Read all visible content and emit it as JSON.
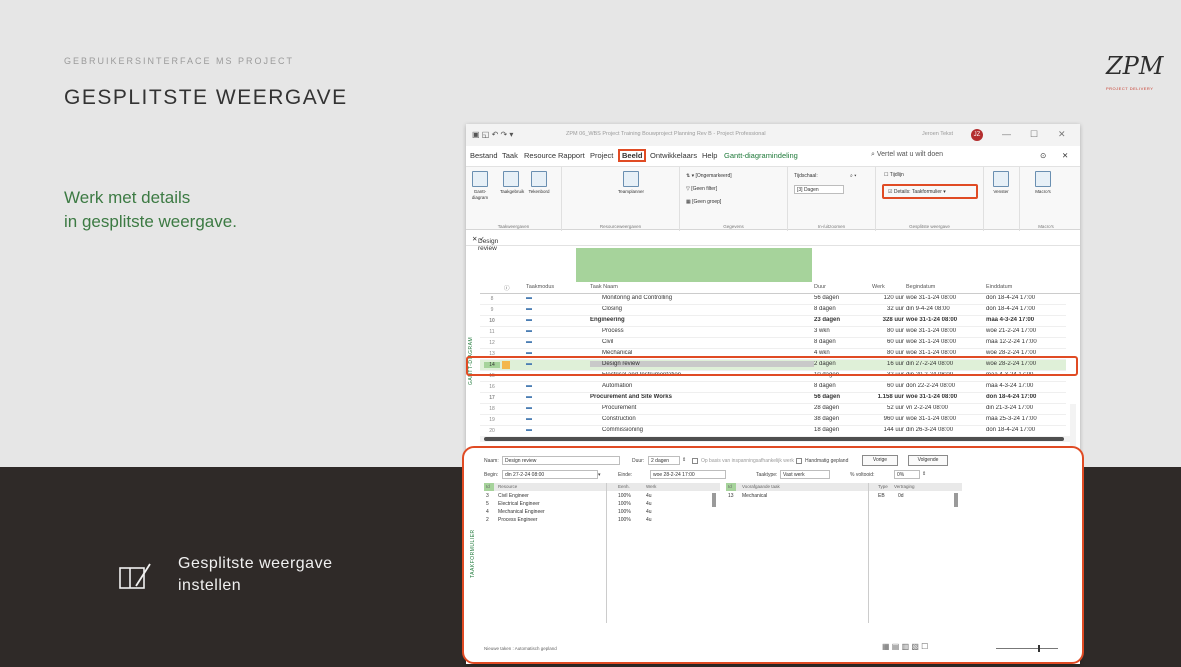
{
  "slide": {
    "eyebrow": "GEBRUIKERSINTERFACE MS PROJECT",
    "title": "GESPLITSTE WEERGAVE",
    "lead": "Werk met details\nin gesplitste weergave.",
    "note": "Gesplitste weergave\ninstellen",
    "logo_mark": "ZPM",
    "logo_sub": "PROJECT DELIVERY"
  },
  "app": {
    "titlebar": {
      "title": "ZPM 06_WBS Project Training Bouwproject Planning Rev B - Project Professional",
      "user": "Jeroen Tekst",
      "avatar": "JZ"
    },
    "menu": [
      "Bestand",
      "Taak",
      "Resource",
      "Rapport",
      "Project",
      "Beeld",
      "Ontwikkelaars",
      "Help",
      "Gantt-diagramindeling"
    ],
    "menu_active": "Beeld",
    "search": "Vertel wat u wilt doen",
    "ribbon": {
      "groups": [
        "Taakweergaven",
        "Resourceweergaven",
        "Gegevens",
        "In-/uitzoomen",
        "Gesplitste weergave",
        "Macro's"
      ],
      "buttons": [
        "Gantt-diagram",
        "Taakgebruik",
        "Tekenbord",
        "Teamplanner",
        "Venster",
        "Macro's"
      ],
      "small": {
        "ongemarkeerd": "[Ongemarkeerd]",
        "geen_filter": "[Geen filter]",
        "geen_groep": "[Geen groep]",
        "tijdschaal": "Tijdschaal:",
        "dagen": "[3] Dagen",
        "tijdlijn": "Tijdlijn",
        "details": "Details: Taakformulier"
      }
    },
    "formula_value": "Design review",
    "gantt": {
      "side_label": "GANTT-DIAGRAM",
      "columns": [
        "Taakmodus",
        "Taak Naam",
        "Duur",
        "Werk",
        "Begindatum",
        "Einddatum"
      ],
      "rows": [
        {
          "id": "8",
          "name": "Monitoring and Controlling",
          "dur": "56 dagen",
          "work": "120 uur",
          "start": "woe 31-1-24 08:00",
          "end": "don 18-4-24 17:00",
          "indent": 1
        },
        {
          "id": "9",
          "name": "Closing",
          "dur": "8 dagen",
          "work": "32 uur",
          "start": "din 9-4-24 08:00",
          "end": "don 18-4-24 17:00",
          "indent": 1
        },
        {
          "id": "10",
          "name": "Engineering",
          "dur": "23 dagen",
          "work": "328 uur",
          "start": "woe 31-1-24 08:00",
          "end": "maa 4-3-24 17:00",
          "indent": 0,
          "summary": true
        },
        {
          "id": "11",
          "name": "Process",
          "dur": "3 wkn",
          "work": "80 uur",
          "start": "woe 31-1-24 08:00",
          "end": "woe 21-2-24 17:00",
          "indent": 1
        },
        {
          "id": "12",
          "name": "Civil",
          "dur": "8 dagen",
          "work": "60 uur",
          "start": "woe 31-1-24 08:00",
          "end": "maa 12-2-24 17:00",
          "indent": 1
        },
        {
          "id": "13",
          "name": "Mechanical",
          "dur": "4 wkn",
          "work": "80 uur",
          "start": "woe 31-1-24 08:00",
          "end": "woe 28-2-24 17:00",
          "indent": 1
        },
        {
          "id": "14",
          "name": "Design review",
          "dur": "2 dagen",
          "work": "16 uur",
          "start": "din 27-2-24 08:00",
          "end": "woe 28-2-24 17:00",
          "indent": 1,
          "selected": true
        },
        {
          "id": "15",
          "name": "Electrical and Instrumentation",
          "dur": "10 dagen",
          "work": "32 uur",
          "start": "din 20-2-24 08:00",
          "end": "maa 4-3-24 17:00",
          "indent": 1
        },
        {
          "id": "16",
          "name": "Automation",
          "dur": "8 dagen",
          "work": "60 uur",
          "start": "don 22-2-24 08:00",
          "end": "maa 4-3-24 17:00",
          "indent": 1
        },
        {
          "id": "17",
          "name": "Procurement and Site Works",
          "dur": "56 dagen",
          "work": "1.158 uur",
          "start": "woe 31-1-24 08:00",
          "end": "don 18-4-24 17:00",
          "indent": 0,
          "summary": true
        },
        {
          "id": "18",
          "name": "Procurement",
          "dur": "28 dagen",
          "work": "52 uur",
          "start": "vri 2-2-24 08:00",
          "end": "din 21-3-24 17:00",
          "indent": 1
        },
        {
          "id": "19",
          "name": "Construction",
          "dur": "38 dagen",
          "work": "960 uur",
          "start": "woe 31-1-24 08:00",
          "end": "maa 25-3-24 17:00",
          "indent": 1
        },
        {
          "id": "20",
          "name": "Commissioning",
          "dur": "18 dagen",
          "work": "144 uur",
          "start": "din 26-3-24 08:00",
          "end": "don 18-4-24 17:00",
          "indent": 1
        }
      ]
    },
    "taskform": {
      "side_label": "TAAKFORMULIER",
      "naam_label": "Naam:",
      "naam_value": "Design review",
      "duur_label": "Duur:",
      "duur_value": "2 dagen",
      "effort_label": "Op basis van inspanningsafhankelijk werk",
      "manual_label": "Handmatig gepland",
      "vorige": "Vorige",
      "volgende": "Volgende",
      "begin_label": "Begin:",
      "begin_value": "din 27-2-24 08:00",
      "einde_label": "Einde:",
      "einde_value": "woe 28-2-24 17:00",
      "taaktype_label": "Taaktype:",
      "taaktype_value": "Vast werk",
      "voltooid_label": "% voltooid:",
      "voltooid_value": "0%",
      "res_cols": [
        "Id",
        "Resource",
        "Eenh.",
        "Werk"
      ],
      "resources": [
        {
          "id": "3",
          "name": "Civil Engineer",
          "units": "100%",
          "work": "4u"
        },
        {
          "id": "5",
          "name": "Electrical Engineer",
          "units": "100%",
          "work": "4u"
        },
        {
          "id": "4",
          "name": "Mechanical Engineer",
          "units": "100%",
          "work": "4u"
        },
        {
          "id": "2",
          "name": "Process Engineer",
          "units": "100%",
          "work": "4u"
        }
      ],
      "pred_cols": [
        "Id",
        "Voorafgaande taak",
        "Type",
        "Vertraging"
      ],
      "predecessors": [
        {
          "id": "13",
          "name": "Mechanical",
          "type": "EB",
          "lag": "0d"
        }
      ],
      "status": "Nieuwe taken : Automatisch gepland"
    }
  },
  "colors": {
    "accent_red": "#e04b24",
    "project_green": "#1f7a3a",
    "header_green": "#a6d39b",
    "dark_band": "#2f2a28"
  }
}
